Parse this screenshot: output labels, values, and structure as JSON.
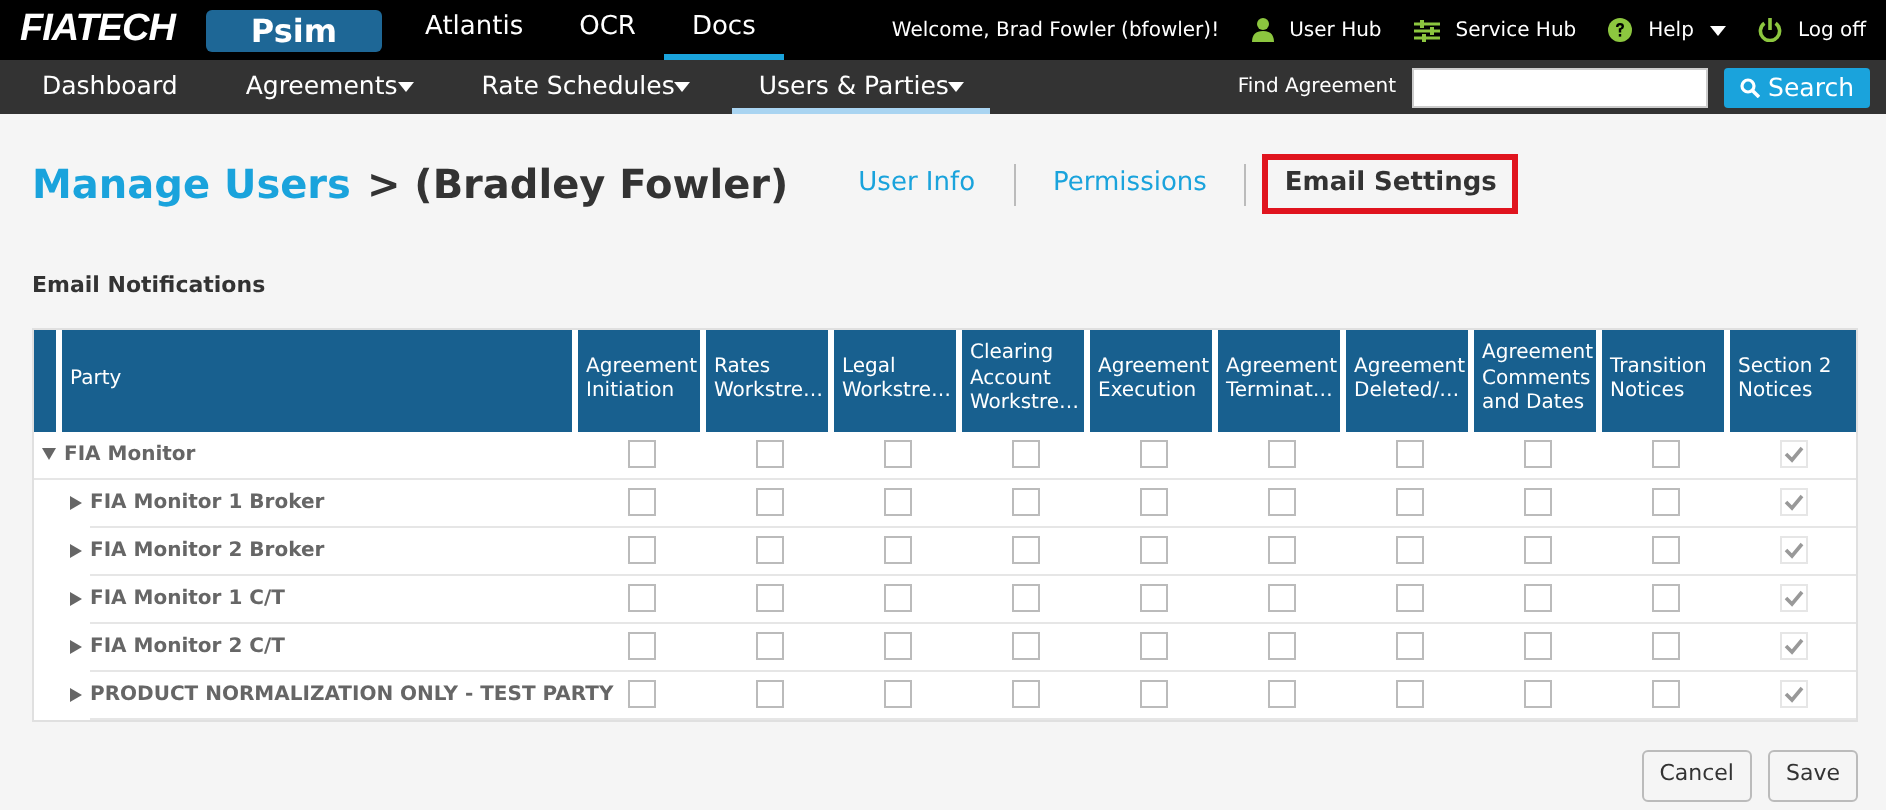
{
  "brand": {
    "logo": "FIATECH"
  },
  "apps": [
    {
      "label": "Psim",
      "kind": "pill"
    },
    {
      "label": "Atlantis",
      "kind": "tab",
      "selected": false
    },
    {
      "label": "OCR",
      "kind": "tab",
      "selected": false
    },
    {
      "label": "Docs",
      "kind": "tab",
      "selected": true
    }
  ],
  "welcome": "Welcome, Brad Fowler (bfowler)!",
  "user_links": [
    {
      "label": "User Hub",
      "kind": "user",
      "dropdown": false
    },
    {
      "label": "Service Hub",
      "kind": "sliders",
      "dropdown": false
    },
    {
      "label": "Help",
      "kind": "help",
      "dropdown": true
    },
    {
      "label": "Log off",
      "kind": "power",
      "dropdown": false
    }
  ],
  "menu": [
    {
      "label": "Dashboard",
      "dropdown": false,
      "selected": false
    },
    {
      "label": "Agreements",
      "dropdown": true,
      "selected": false
    },
    {
      "label": "Rate Schedules",
      "dropdown": true,
      "selected": false
    },
    {
      "label": "Users & Parties",
      "dropdown": true,
      "selected": true
    }
  ],
  "find": {
    "label": "Find Agreement",
    "button": "Search"
  },
  "heading": {
    "link": "Manage Users",
    "rest": "> (Bradley Fowler)"
  },
  "tabs": [
    {
      "label": "User Info",
      "selected": false,
      "highlighted": false
    },
    {
      "label": "Permissions",
      "selected": false,
      "highlighted": false
    },
    {
      "label": "Email Settings",
      "selected": true,
      "highlighted": true
    }
  ],
  "section_title": "Email Notifications",
  "table": {
    "columns": [
      "Party",
      "Agreement Initiation",
      "Rates Workstre…",
      "Legal Workstre…",
      "Clearing Account Workstre…",
      "Agreement Execution",
      "Agreement Terminat…",
      "Agreement Deleted/…",
      "Agreement Comments and Dates",
      "Transition Notices",
      "Section 2 Notices"
    ],
    "rows": [
      {
        "party": "FIA Monitor",
        "expanded": true,
        "checks": [
          {
            "checked": false,
            "disabled": false
          },
          {
            "checked": false,
            "disabled": false
          },
          {
            "checked": false,
            "disabled": false
          },
          {
            "checked": false,
            "disabled": false
          },
          {
            "checked": false,
            "disabled": false
          },
          {
            "checked": false,
            "disabled": false
          },
          {
            "checked": false,
            "disabled": false
          },
          {
            "checked": false,
            "disabled": false
          },
          {
            "checked": false,
            "disabled": false
          },
          {
            "checked": true,
            "disabled": true
          }
        ],
        "children": [
          {
            "party": "FIA Monitor 1 Broker",
            "expanded": false,
            "checks": [
              {
                "checked": false,
                "disabled": false
              },
              {
                "checked": false,
                "disabled": false
              },
              {
                "checked": false,
                "disabled": false
              },
              {
                "checked": false,
                "disabled": false
              },
              {
                "checked": false,
                "disabled": false
              },
              {
                "checked": false,
                "disabled": false
              },
              {
                "checked": false,
                "disabled": false
              },
              {
                "checked": false,
                "disabled": false
              },
              {
                "checked": false,
                "disabled": false
              },
              {
                "checked": true,
                "disabled": true
              }
            ]
          },
          {
            "party": "FIA Monitor 2 Broker",
            "expanded": false,
            "checks": [
              {
                "checked": false,
                "disabled": false
              },
              {
                "checked": false,
                "disabled": false
              },
              {
                "checked": false,
                "disabled": false
              },
              {
                "checked": false,
                "disabled": false
              },
              {
                "checked": false,
                "disabled": false
              },
              {
                "checked": false,
                "disabled": false
              },
              {
                "checked": false,
                "disabled": false
              },
              {
                "checked": false,
                "disabled": false
              },
              {
                "checked": false,
                "disabled": false
              },
              {
                "checked": true,
                "disabled": true
              }
            ]
          },
          {
            "party": "FIA Monitor 1 C/T",
            "expanded": false,
            "checks": [
              {
                "checked": false,
                "disabled": false
              },
              {
                "checked": false,
                "disabled": false
              },
              {
                "checked": false,
                "disabled": false
              },
              {
                "checked": false,
                "disabled": false
              },
              {
                "checked": false,
                "disabled": false
              },
              {
                "checked": false,
                "disabled": false
              },
              {
                "checked": false,
                "disabled": false
              },
              {
                "checked": false,
                "disabled": false
              },
              {
                "checked": false,
                "disabled": false
              },
              {
                "checked": true,
                "disabled": true
              }
            ]
          },
          {
            "party": "FIA Monitor 2 C/T",
            "expanded": false,
            "checks": [
              {
                "checked": false,
                "disabled": false
              },
              {
                "checked": false,
                "disabled": false
              },
              {
                "checked": false,
                "disabled": false
              },
              {
                "checked": false,
                "disabled": false
              },
              {
                "checked": false,
                "disabled": false
              },
              {
                "checked": false,
                "disabled": false
              },
              {
                "checked": false,
                "disabled": false
              },
              {
                "checked": false,
                "disabled": false
              },
              {
                "checked": false,
                "disabled": false
              },
              {
                "checked": true,
                "disabled": true
              }
            ]
          },
          {
            "party": "PRODUCT NORMALIZATION ONLY - TEST PARTY",
            "expanded": false,
            "checks": [
              {
                "checked": false,
                "disabled": false
              },
              {
                "checked": false,
                "disabled": false
              },
              {
                "checked": false,
                "disabled": false
              },
              {
                "checked": false,
                "disabled": false
              },
              {
                "checked": false,
                "disabled": false
              },
              {
                "checked": false,
                "disabled": false
              },
              {
                "checked": false,
                "disabled": false
              },
              {
                "checked": false,
                "disabled": false
              },
              {
                "checked": false,
                "disabled": false
              },
              {
                "checked": true,
                "disabled": true
              }
            ]
          }
        ]
      }
    ]
  },
  "buttons": [
    "Cancel",
    "Save"
  ]
}
